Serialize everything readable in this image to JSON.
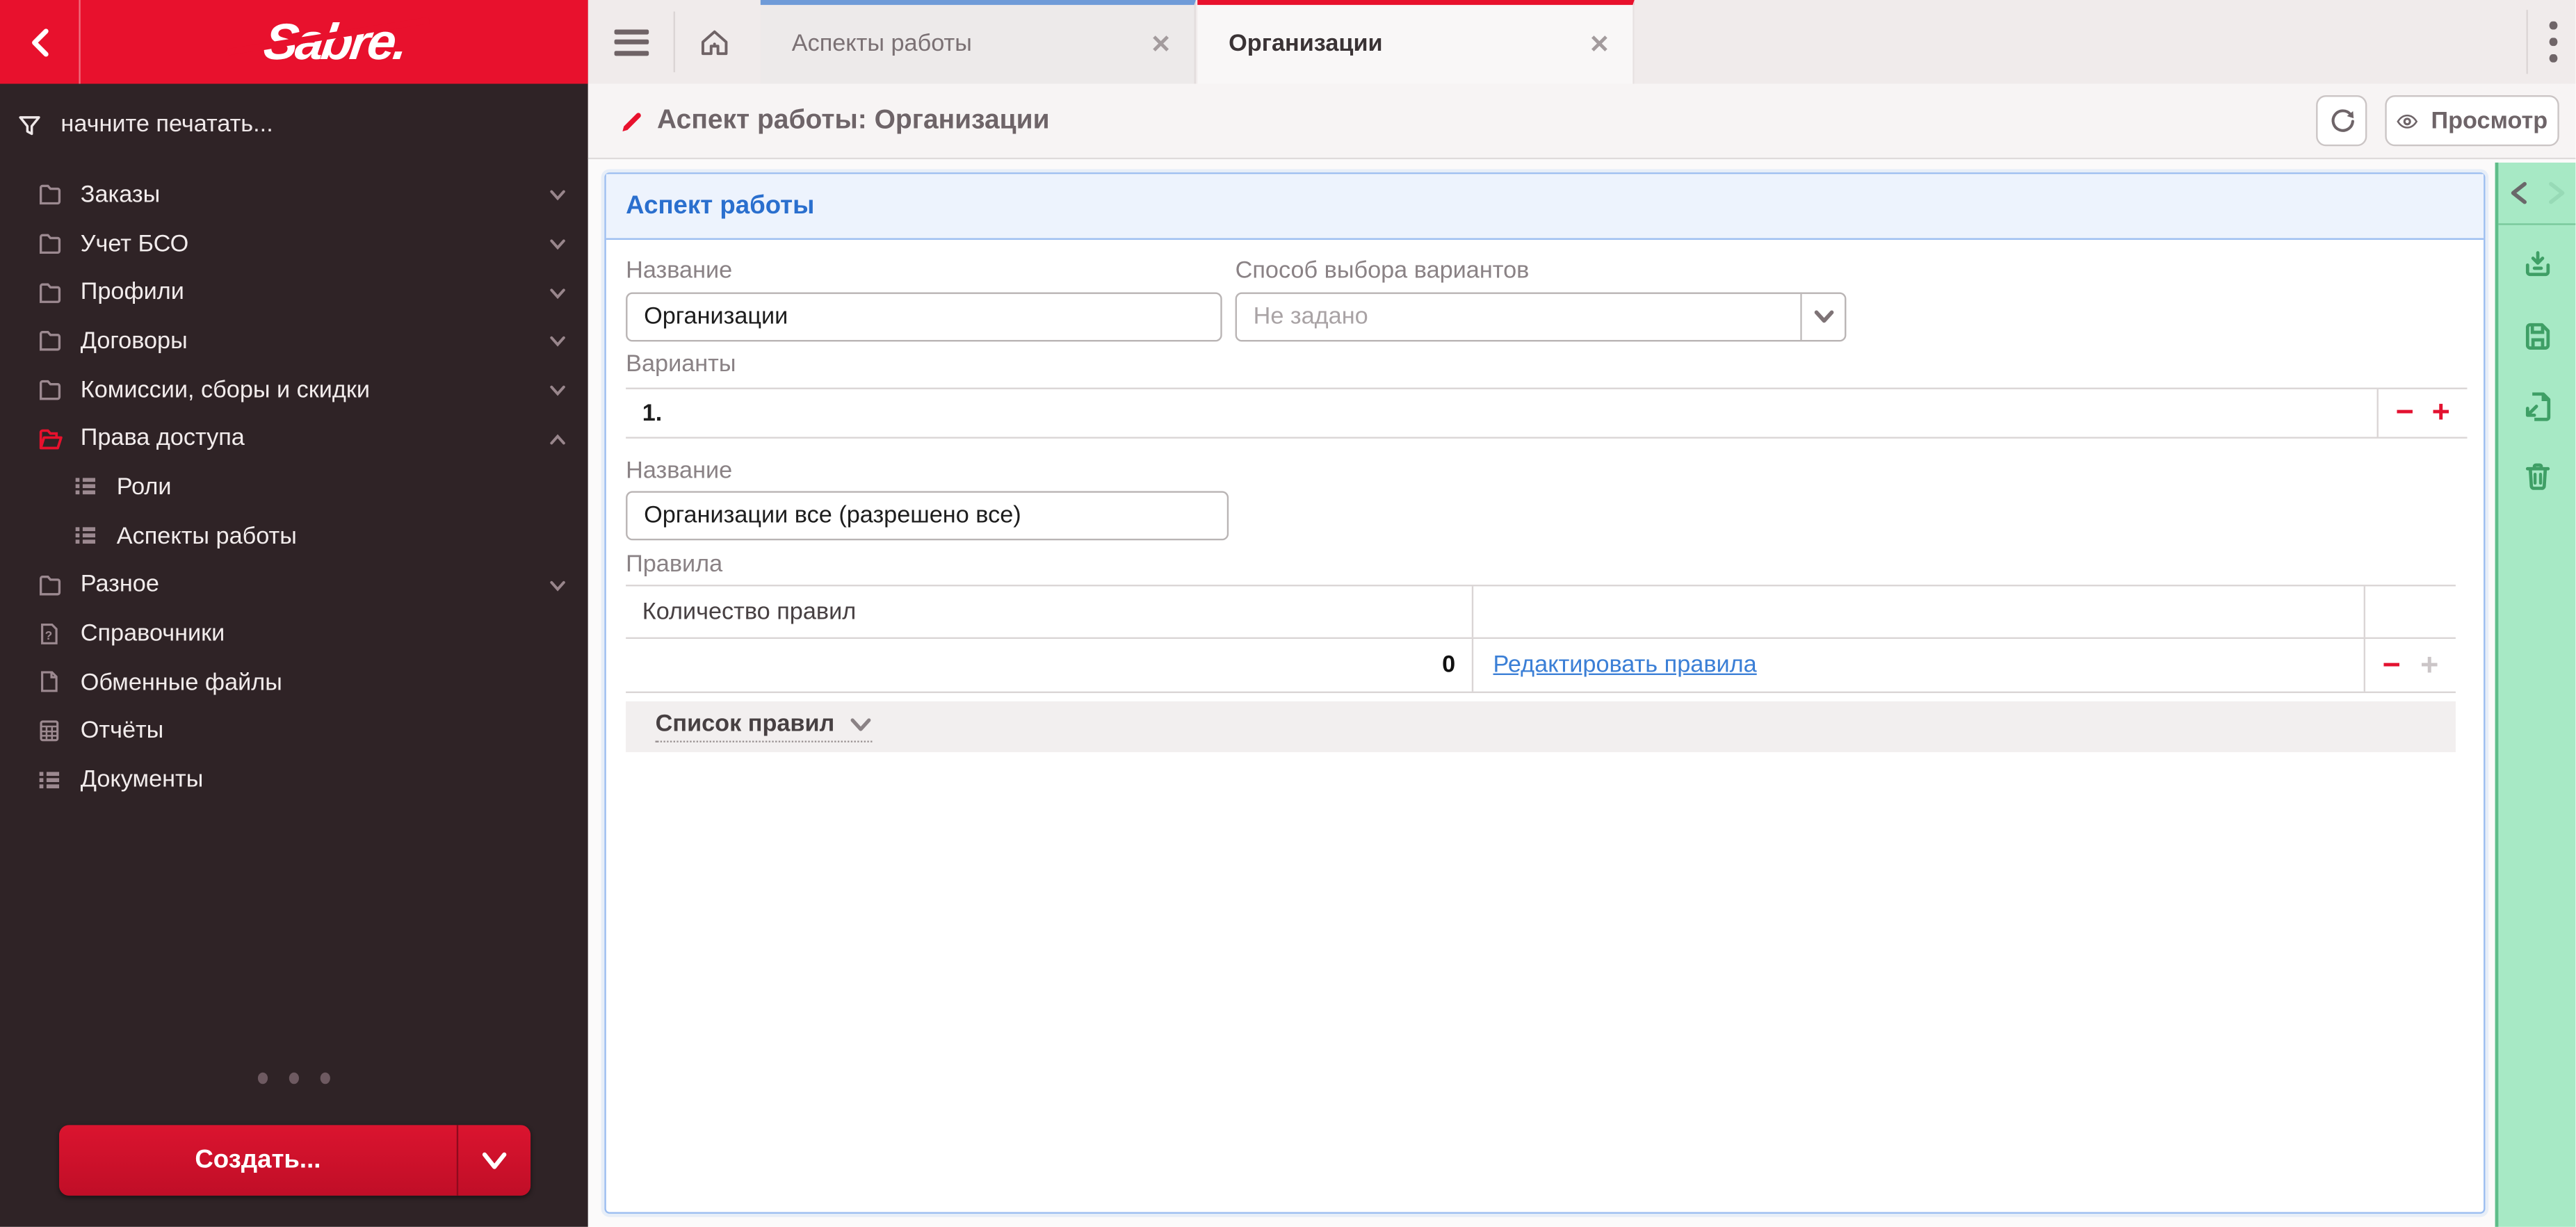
{
  "colors": {
    "sabre_red": "#E8112D",
    "sidebar_bg": "#2F2326",
    "accent_blue": "#2A6FCE",
    "panel_border": "#9BBDF0",
    "link_blue": "#3B7FD6",
    "tab_active_accent": "#E8112D",
    "tab_inactive_accent": "#6F9BD8",
    "toolbar_green_bg": "#A7E9C5",
    "toolbar_green_icon": "#3F9F66"
  },
  "sidebar": {
    "logo": "Sabre.",
    "filter_placeholder": "начните печатать...",
    "items": [
      {
        "label": "Заказы",
        "icon": "folder",
        "chevron": "down"
      },
      {
        "label": "Учет БСО",
        "icon": "folder",
        "chevron": "down"
      },
      {
        "label": "Профили",
        "icon": "folder",
        "chevron": "down"
      },
      {
        "label": "Договоры",
        "icon": "folder",
        "chevron": "down"
      },
      {
        "label": "Комиссии, сборы и скидки",
        "icon": "folder",
        "chevron": "down"
      },
      {
        "label": "Права доступа",
        "icon": "folder-open",
        "chevron": "up",
        "active": true
      },
      {
        "label": "Роли",
        "icon": "list",
        "child": true
      },
      {
        "label": "Аспекты работы",
        "icon": "list",
        "child": true
      },
      {
        "label": "Разное",
        "icon": "folder",
        "chevron": "down"
      },
      {
        "label": "Справочники",
        "icon": "file-question"
      },
      {
        "label": "Обменные файлы",
        "icon": "file"
      },
      {
        "label": "Отчёты",
        "icon": "report-grid"
      },
      {
        "label": "Документы",
        "icon": "list"
      }
    ],
    "create_button": "Создать..."
  },
  "tabbar": {
    "tabs": [
      {
        "label": "Аспекты работы",
        "active": false
      },
      {
        "label": "Организации",
        "active": true
      }
    ],
    "close_glyph": "✕"
  },
  "titlebar": {
    "title": "Аспект работы: Организации",
    "view_button": "Просмотр"
  },
  "panel": {
    "title": "Аспект работы",
    "fields": {
      "name_label": "Название",
      "name_value": "Организации",
      "method_label": "Способ выбора вариантов",
      "method_placeholder": "Не задано"
    },
    "variants": {
      "label": "Варианты",
      "row_index": "1.",
      "controls": {
        "remove": "−",
        "add": "+"
      },
      "name_label": "Название",
      "name_value": "Организации все (разрешено все)",
      "rules_label": "Правила",
      "rules_table": {
        "count_header": "Количество правил",
        "count_value": "0",
        "edit_link": "Редактировать правила"
      },
      "rules_list_toggle": "Список правил"
    }
  },
  "right_toolbar": {
    "icons": [
      "download",
      "save",
      "export",
      "delete"
    ]
  }
}
